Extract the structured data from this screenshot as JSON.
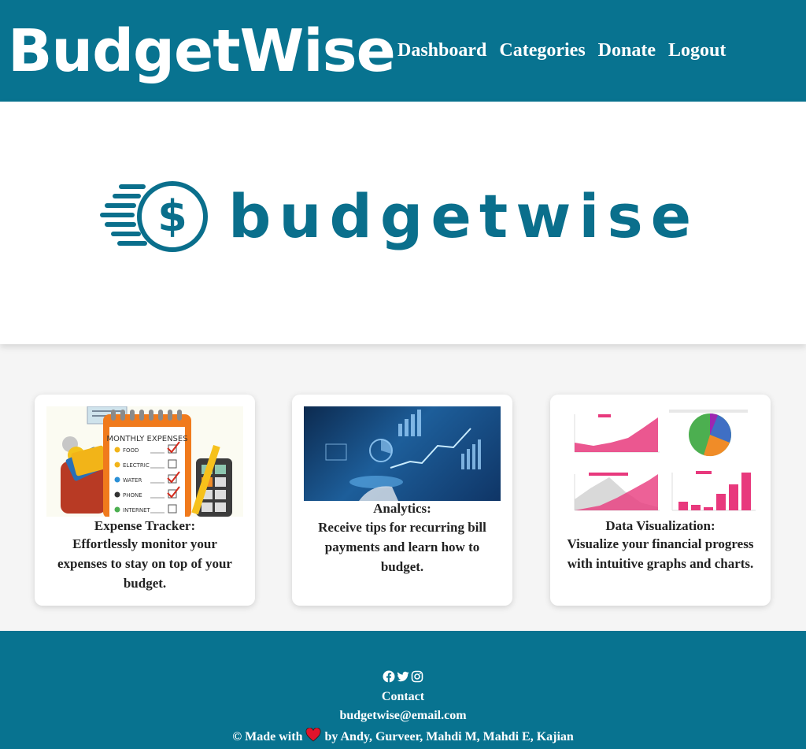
{
  "header": {
    "brand": "BudgetWise",
    "nav": [
      "Dashboard",
      "Categories",
      "Donate",
      "Logout"
    ]
  },
  "hero": {
    "logo_text": "budgetwise",
    "logo_icon": "dollar-coin-icon"
  },
  "cards": [
    {
      "title": "Expense Tracker:",
      "description": "Effortlessly monitor your expenses to stay on top of your budget.",
      "image": {
        "heading": "MONTHLY EXPENSES",
        "items": [
          "FOOD",
          "ELECTRIC",
          "WATER",
          "PHONE",
          "INTERNET"
        ],
        "checked": [
          true,
          false,
          true,
          true,
          false
        ]
      }
    },
    {
      "title": "Analytics:",
      "description": "Receive tips for recurring bill payments and learn how to budget."
    },
    {
      "title": "Data Visualization:",
      "description": "Visualize your financial progress with intuitive graphs and charts."
    }
  ],
  "footer": {
    "icons": [
      "facebook-icon",
      "twitter-icon",
      "instagram-icon"
    ],
    "contact_label": "Contact",
    "email": "budgetwise@email.com",
    "made_with_prefix": "© Made with",
    "made_with_suffix": "by Andy, Gurveer, Mahdi M, Mahdi E, Kajian"
  },
  "colors": {
    "brand_teal": "#087390",
    "logo_teal": "#0a6f8c",
    "chart_pink": "#e8397d",
    "heart_red": "#e0142b"
  }
}
